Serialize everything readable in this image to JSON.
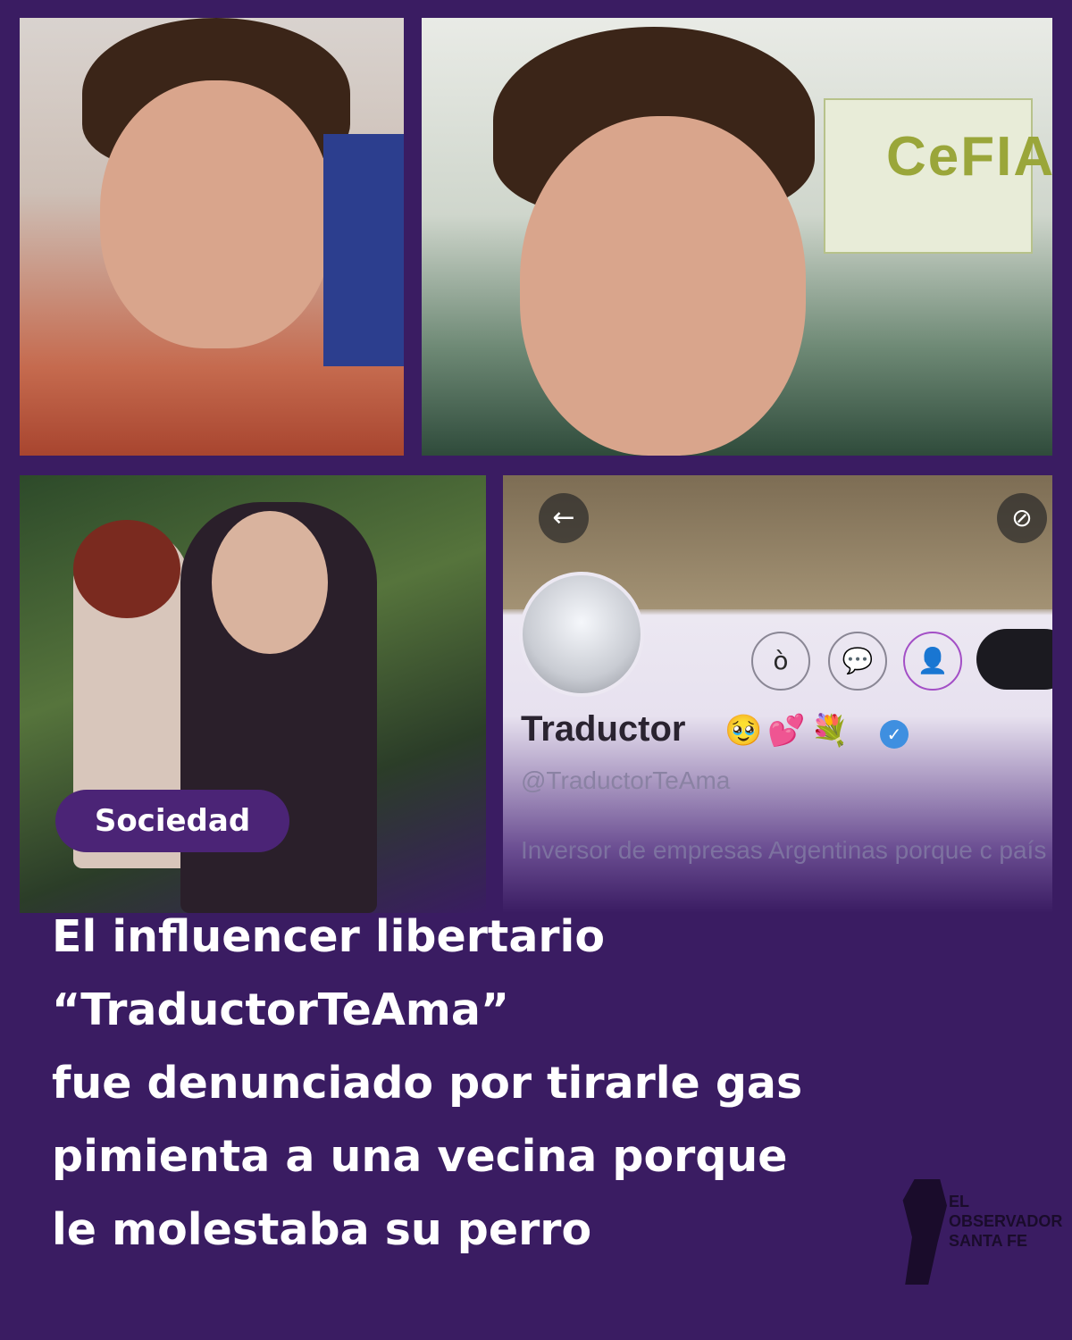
{
  "collage": {
    "photo_top_left": "man-selfie-red-shirt",
    "photo_top_right": "man-portrait-cefia-sign",
    "photo_bottom_left": "two-women-in-forest",
    "photo_bottom_right": "twitter-profile-screenshot"
  },
  "sign": {
    "text": "CeFIA"
  },
  "profile": {
    "back_icon": "←",
    "more_icon": "⊘",
    "name": "Traductor",
    "emojis": "🥹💕💐",
    "verified_icon": "✓",
    "handle": "@TraductorTeAma",
    "bio": "Inversor de empresas Argentinas porque c país.",
    "actions": [
      "ò",
      "💬",
      "👤"
    ]
  },
  "category_badge": "Sociedad",
  "headline": {
    "lines": [
      "El influencer libertario",
      "“TraductorTeAma”",
      "fue denunciado por tirarle gas",
      "pimienta a una vecina porque",
      "le molestaba su perro"
    ]
  },
  "brand": {
    "lines": [
      "El",
      "Observador",
      "Santa Fe"
    ]
  },
  "colors": {
    "background": "#3a1c62",
    "badge": "#4b2476",
    "text": "#ffffff"
  }
}
